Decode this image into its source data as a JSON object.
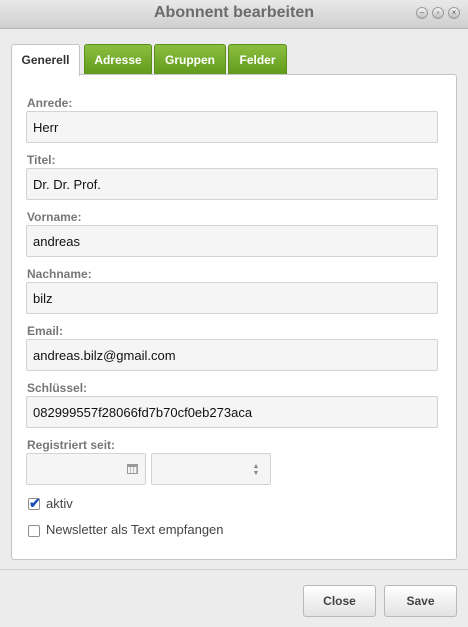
{
  "window": {
    "title": "Abonnent bearbeiten"
  },
  "tabs": [
    {
      "label": "Generell",
      "active": true
    },
    {
      "label": "Adresse",
      "active": false
    },
    {
      "label": "Gruppen",
      "active": false
    },
    {
      "label": "Felder",
      "active": false
    }
  ],
  "form": {
    "anrede": {
      "label": "Anrede:",
      "value": "Herr"
    },
    "titel": {
      "label": "Titel:",
      "value": "Dr. Dr. Prof."
    },
    "vorname": {
      "label": "Vorname:",
      "value": "andreas"
    },
    "nachname": {
      "label": "Nachname:",
      "value": "bilz"
    },
    "email": {
      "label": "Email:",
      "value": "andreas.bilz@gmail.com"
    },
    "schluessel": {
      "label": "Schlüssel:",
      "value": "082999557f28066fd7b70cf0eb273aca"
    },
    "registriert": {
      "label": "Registriert seit:",
      "date_value": "",
      "time_value": ""
    },
    "aktiv": {
      "label": "aktiv",
      "checked": true
    },
    "newsletter_text": {
      "label": "Newsletter als Text empfangen",
      "checked": false
    }
  },
  "footer": {
    "close_label": "Close",
    "save_label": "Save"
  },
  "colors": {
    "tab_green": "#6fa82a",
    "check_blue": "#1e4fb5"
  },
  "icons": [
    "minimize-icon",
    "restore-icon",
    "close-icon",
    "calendar-icon",
    "updown-icon",
    "checkmark-icon"
  ]
}
